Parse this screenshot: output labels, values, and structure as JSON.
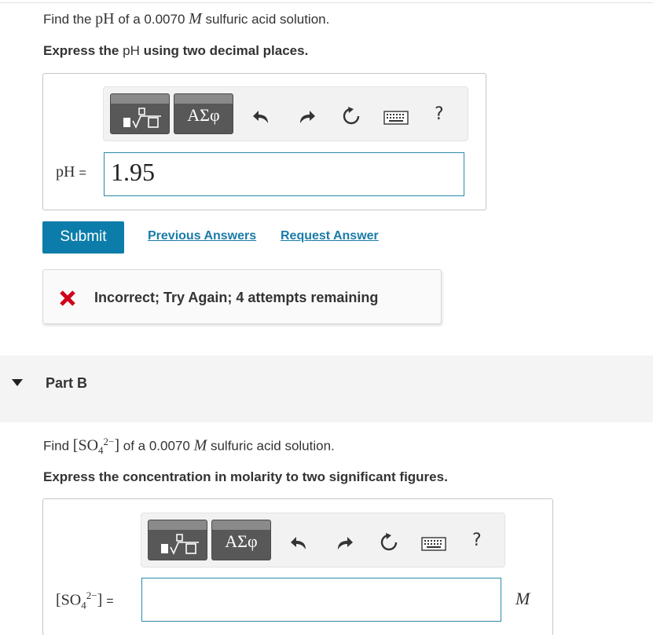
{
  "part_a": {
    "question": {
      "prefix": "Find the ",
      "ph_symbol": "pH",
      "middle": " of a 0.0070 ",
      "molar_symbol": "M",
      "suffix": " sulfuric acid solution."
    },
    "instruction": {
      "prefix": "Express the ",
      "ph_symbol": "pH",
      "suffix": " using two decimal places."
    },
    "toolbar": {
      "greek_label": "ΑΣφ",
      "help_label": "?",
      "icons": [
        "templates-icon",
        "greek-symbols-icon",
        "undo-icon",
        "redo-icon",
        "reset-icon",
        "keyboard-icon",
        "help-icon"
      ]
    },
    "input_label": "pH",
    "equals": "=",
    "input_value": "1.95",
    "submit_label": "Submit",
    "previous_answers_label": "Previous Answers",
    "request_answer_label": "Request Answer",
    "feedback_text": "Incorrect; Try Again; 4 attempts remaining"
  },
  "part_b": {
    "title": "Part B",
    "question": {
      "prefix": "Find ",
      "species_base": "[SO",
      "species_sub": "4",
      "species_sup": "2−",
      "species_close": "]",
      "middle": " of a 0.0070 ",
      "molar_symbol": "M",
      "suffix": " sulfuric acid solution."
    },
    "instruction": "Express the concentration in molarity to two significant figures.",
    "toolbar": {
      "greek_label": "ΑΣφ",
      "help_label": "?"
    },
    "input_label": {
      "base": "[SO",
      "sub": "4",
      "sup": "2−",
      "close": "]",
      "equals": "="
    },
    "input_value": "",
    "unit": "M"
  },
  "colors": {
    "submit_bg": "#0c7daa",
    "link": "#1a7ba8",
    "input_border": "#2b8ba6",
    "error_x": "#d0021b",
    "toolbar_button": "#585858"
  }
}
